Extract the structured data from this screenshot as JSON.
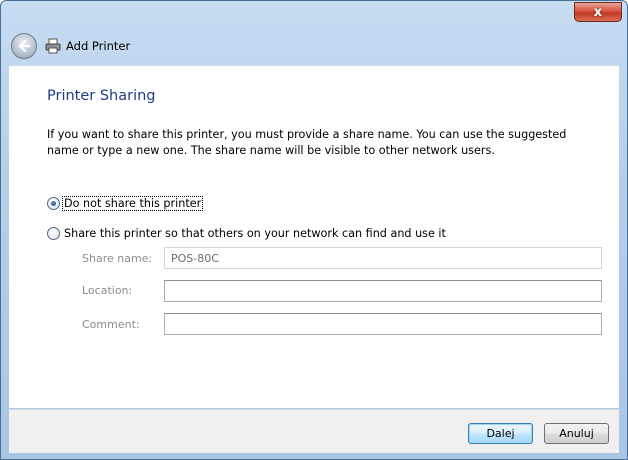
{
  "window": {
    "close_glyph": "x",
    "nav_title": "Add Printer"
  },
  "page": {
    "heading": "Printer Sharing",
    "description": "If you want to share this printer, you must provide a share name. You can use the suggested name or type a new one. The share name will be visible to other network users."
  },
  "options": {
    "no_share_label": "Do not share this printer",
    "no_share_selected": true,
    "share_label": "Share this printer so that others on your network can find and use it",
    "share_selected": false
  },
  "fields": {
    "share_name_label": "Share name:",
    "share_name_value": "POS-80C",
    "location_label": "Location:",
    "location_value": "",
    "comment_label": "Comment:",
    "comment_value": ""
  },
  "footer": {
    "next_label": "Dalej",
    "cancel_label": "Anuluj"
  },
  "icons": {
    "back": "back-arrow-icon",
    "printer": "printer-icon",
    "close": "close-icon"
  },
  "colors": {
    "heading": "#1f3c88",
    "close_button": "#c23a22",
    "frame": "#b5cfe9"
  }
}
